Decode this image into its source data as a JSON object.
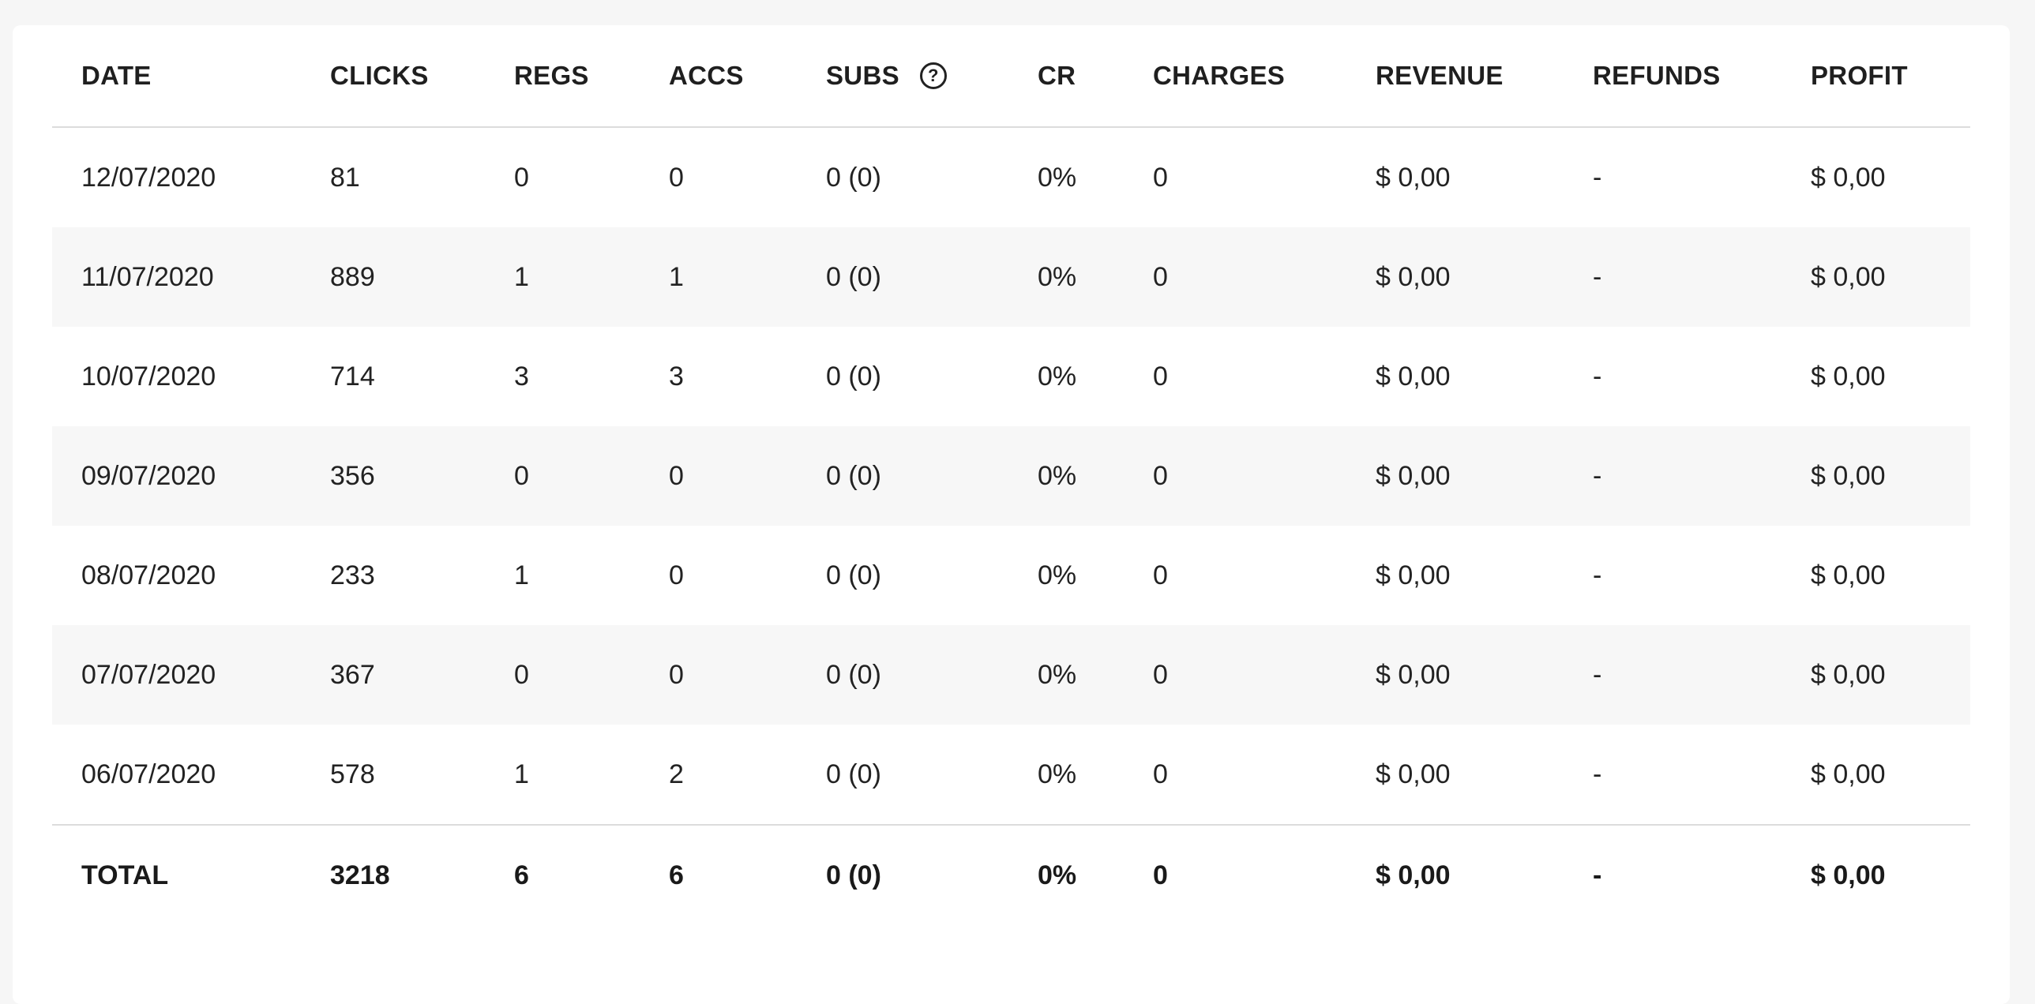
{
  "table": {
    "headers": {
      "date": "DATE",
      "clicks": "CLICKS",
      "regs": "REGS",
      "accs": "ACCS",
      "subs": "SUBS",
      "cr": "CR",
      "charges": "CHARGES",
      "revenue": "REVENUE",
      "refunds": "REFUNDS",
      "profit": "PROFIT"
    },
    "subs_help_icon": "?",
    "rows": [
      {
        "date": "12/07/2020",
        "clicks": "81",
        "regs": "0",
        "accs": "0",
        "subs": "0 (0)",
        "cr": "0%",
        "charges": "0",
        "revenue": "$ 0,00",
        "refunds": "-",
        "profit": "$ 0,00"
      },
      {
        "date": "11/07/2020",
        "clicks": "889",
        "regs": "1",
        "accs": "1",
        "subs": "0 (0)",
        "cr": "0%",
        "charges": "0",
        "revenue": "$ 0,00",
        "refunds": "-",
        "profit": "$ 0,00"
      },
      {
        "date": "10/07/2020",
        "clicks": "714",
        "regs": "3",
        "accs": "3",
        "subs": "0 (0)",
        "cr": "0%",
        "charges": "0",
        "revenue": "$ 0,00",
        "refunds": "-",
        "profit": "$ 0,00"
      },
      {
        "date": "09/07/2020",
        "clicks": "356",
        "regs": "0",
        "accs": "0",
        "subs": "0 (0)",
        "cr": "0%",
        "charges": "0",
        "revenue": "$ 0,00",
        "refunds": "-",
        "profit": "$ 0,00"
      },
      {
        "date": "08/07/2020",
        "clicks": "233",
        "regs": "1",
        "accs": "0",
        "subs": "0 (0)",
        "cr": "0%",
        "charges": "0",
        "revenue": "$ 0,00",
        "refunds": "-",
        "profit": "$ 0,00"
      },
      {
        "date": "07/07/2020",
        "clicks": "367",
        "regs": "0",
        "accs": "0",
        "subs": "0 (0)",
        "cr": "0%",
        "charges": "0",
        "revenue": "$ 0,00",
        "refunds": "-",
        "profit": "$ 0,00"
      },
      {
        "date": "06/07/2020",
        "clicks": "578",
        "regs": "1",
        "accs": "2",
        "subs": "0 (0)",
        "cr": "0%",
        "charges": "0",
        "revenue": "$ 0,00",
        "refunds": "-",
        "profit": "$ 0,00"
      }
    ],
    "total": {
      "date": "TOTAL",
      "clicks": "3218",
      "regs": "6",
      "accs": "6",
      "subs": "0 (0)",
      "cr": "0%",
      "charges": "0",
      "revenue": "$ 0,00",
      "refunds": "-",
      "profit": "$ 0,00"
    }
  },
  "colors": {
    "background": "#f6f6f6",
    "card": "#ffffff",
    "alt_row": "#f7f7f7",
    "divider": "#dcdcdc",
    "text": "#222222"
  }
}
